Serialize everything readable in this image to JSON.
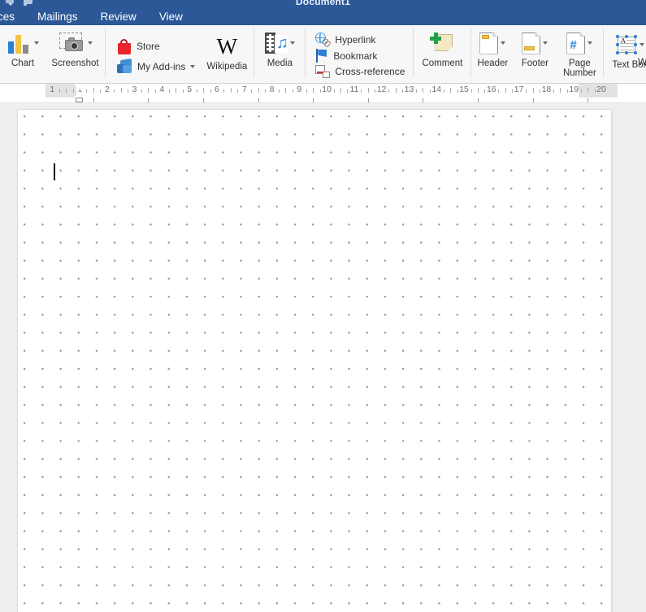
{
  "window": {
    "title": "Document1",
    "titlebar_color": "#2c5898",
    "quick_access": [
      {
        "name": "save-icon"
      },
      {
        "name": "undo-icon"
      }
    ]
  },
  "ribbon": {
    "tabs": [
      {
        "label": "ces",
        "clipped": true,
        "active": false
      },
      {
        "label": "Mailings",
        "active": false
      },
      {
        "label": "Review",
        "active": false
      },
      {
        "label": "View",
        "active": false
      }
    ],
    "active_tab": "Insert",
    "groups": [
      {
        "name": "illustrations",
        "items": [
          {
            "label": "Chart",
            "icon": "chart-icon",
            "has_caret": true
          },
          {
            "label": "Screenshot",
            "icon": "screenshot-icon",
            "has_caret": true
          }
        ]
      },
      {
        "name": "add-ins",
        "items": [
          {
            "label": "Store",
            "icon": "store-icon",
            "has_caret": false
          },
          {
            "label": "My Add-ins",
            "icon": "my-add-ins-icon",
            "has_caret": true
          }
        ]
      },
      {
        "name": "wikipedia",
        "items": [
          {
            "label": "Wikipedia",
            "icon": "wikipedia-icon",
            "has_caret": false
          }
        ]
      },
      {
        "name": "media",
        "items": [
          {
            "label": "Media",
            "icon": "media-icon",
            "has_caret": true
          }
        ]
      },
      {
        "name": "links",
        "items": [
          {
            "label": "Hyperlink",
            "icon": "hyperlink-icon",
            "has_caret": false
          },
          {
            "label": "Bookmark",
            "icon": "bookmark-icon",
            "has_caret": false
          },
          {
            "label": "Cross-reference",
            "icon": "cross-reference-icon",
            "has_caret": false
          }
        ]
      },
      {
        "name": "comments",
        "items": [
          {
            "label": "Comment",
            "icon": "comment-icon",
            "has_caret": false
          }
        ]
      },
      {
        "name": "header-footer",
        "items": [
          {
            "label": "Header",
            "icon": "header-icon",
            "has_caret": true
          },
          {
            "label": "Footer",
            "icon": "footer-icon",
            "has_caret": true
          },
          {
            "label": "Page Number",
            "icon": "page-number-icon",
            "has_caret": true
          }
        ]
      },
      {
        "name": "text",
        "items": [
          {
            "label": "Text Box",
            "icon": "text-box-icon",
            "has_caret": true
          },
          {
            "label": "W",
            "icon": "wordart-icon",
            "has_caret": false,
            "clipped": true
          }
        ]
      }
    ],
    "labels": {
      "chart": "Chart",
      "screenshot": "Screenshot",
      "store": "Store",
      "my_add_ins": "My Add-ins",
      "wikipedia": "Wikipedia",
      "media": "Media",
      "hyperlink": "Hyperlink",
      "bookmark": "Bookmark",
      "cross_reference": "Cross-reference",
      "comment": "Comment",
      "header": "Header",
      "footer": "Footer",
      "page_number": "Page Number",
      "text_box": "Text Box",
      "wordart_clipped": "W"
    }
  },
  "ruler": {
    "unit": "cm",
    "numbers": [
      1,
      1,
      2,
      3,
      4,
      5,
      6,
      7,
      8,
      9,
      10,
      11,
      12,
      13,
      14,
      15,
      16,
      17,
      18,
      19,
      20
    ],
    "left_margin_label": "1",
    "left_indent_position": "1",
    "right_indent_position": "19",
    "tick_color": "#a8a8a8",
    "margin_color": "#e2e2e2"
  },
  "document": {
    "page_background": "#ffffff",
    "canvas_background": "#efefef",
    "grid_visible": true,
    "grid_dot_color": "#9b9b9b",
    "grid_spacing_px": 22,
    "cursor_visible": true,
    "text": ""
  }
}
